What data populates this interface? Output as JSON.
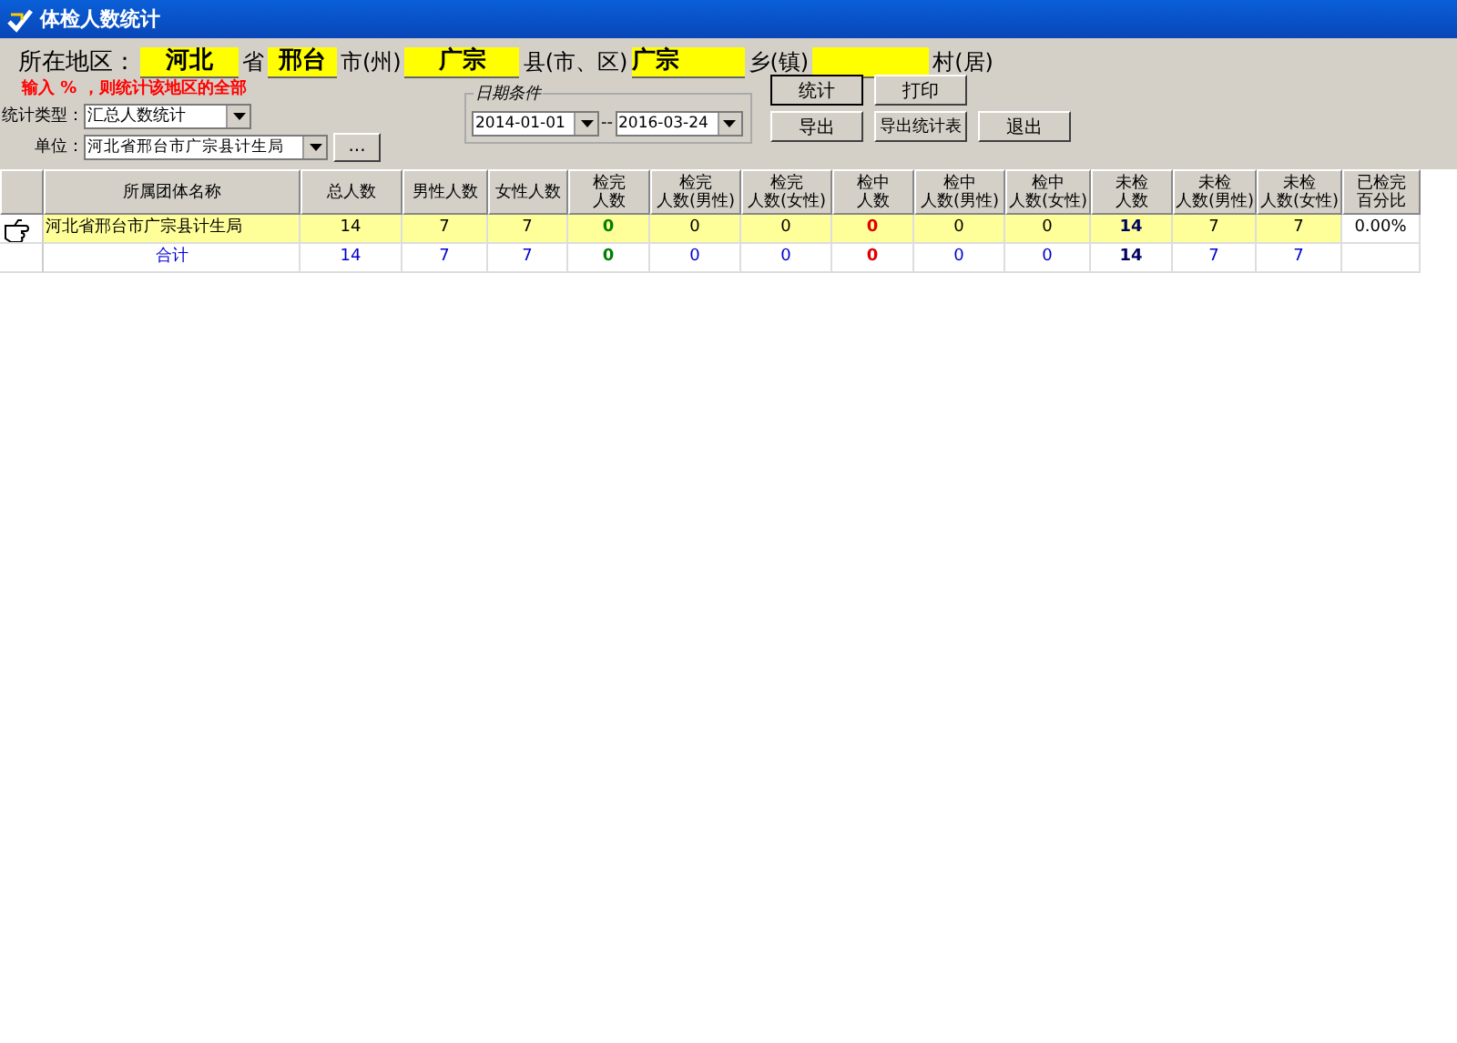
{
  "window": {
    "title": "体检人数统计"
  },
  "region": {
    "label": "所在地区：",
    "fields": [
      {
        "value": "河北",
        "suffix": "省"
      },
      {
        "value": "邢台",
        "suffix": "市(州)"
      },
      {
        "value": "广宗",
        "suffix": "县(市、区)"
      },
      {
        "value": "广宗",
        "suffix": "乡(镇)"
      },
      {
        "suffix": "村(居)"
      }
    ]
  },
  "warning": "输入 % ，则统计该地区的全部",
  "stat_type": {
    "label": "统计类型：",
    "value": "汇总人数统计"
  },
  "unit": {
    "label": "单位：",
    "value": "河北省邢台市广宗县计生局",
    "browse": "..."
  },
  "date_group": {
    "title": "日期条件",
    "from": "2014-01-01",
    "separator": "--",
    "to": "2016-03-24"
  },
  "buttons": [
    {
      "label": "统计",
      "focused": true
    },
    {
      "label": "打印",
      "focused": false
    },
    {
      "label": "导出",
      "focused": false
    },
    {
      "label": "导出统计表",
      "focused": false
    },
    {
      "label": "退出",
      "focused": false
    }
  ],
  "table": {
    "columns": [
      {
        "lines": [
          "所属团体名称"
        ],
        "kind": "name"
      },
      {
        "lines": [
          "总人数"
        ],
        "kind": "plain"
      },
      {
        "lines": [
          "男性人数"
        ],
        "kind": "plain"
      },
      {
        "lines": [
          "女性人数"
        ],
        "kind": "plain"
      },
      {
        "lines": [
          "检完",
          "人数"
        ],
        "kind": "done"
      },
      {
        "lines": [
          "检完",
          "人数(男性)"
        ],
        "kind": "plain"
      },
      {
        "lines": [
          "检完",
          "人数(女性)"
        ],
        "kind": "plain"
      },
      {
        "lines": [
          "检中",
          "人数"
        ],
        "kind": "progress"
      },
      {
        "lines": [
          "检中",
          "人数(男性)"
        ],
        "kind": "plain"
      },
      {
        "lines": [
          "检中",
          "人数(女性)"
        ],
        "kind": "plain"
      },
      {
        "lines": [
          "未检",
          "人数"
        ],
        "kind": "pending"
      },
      {
        "lines": [
          "未检",
          "人数(男性)"
        ],
        "kind": "plain"
      },
      {
        "lines": [
          "未检",
          "人数(女性)"
        ],
        "kind": "plain"
      },
      {
        "lines": [
          "已检完",
          "百分比"
        ],
        "kind": "percent"
      }
    ],
    "rows": [
      {
        "kind": "data",
        "selected": true,
        "cells": [
          "河北省邢台市广宗县计生局",
          "14",
          "7",
          "7",
          "0",
          "0",
          "0",
          "0",
          "0",
          "0",
          "14",
          "7",
          "7",
          "0.00%"
        ]
      },
      {
        "kind": "total",
        "selected": false,
        "cells": [
          "合计",
          "14",
          "7",
          "7",
          "0",
          "0",
          "0",
          "0",
          "0",
          "0",
          "14",
          "7",
          "7",
          ""
        ]
      }
    ]
  }
}
